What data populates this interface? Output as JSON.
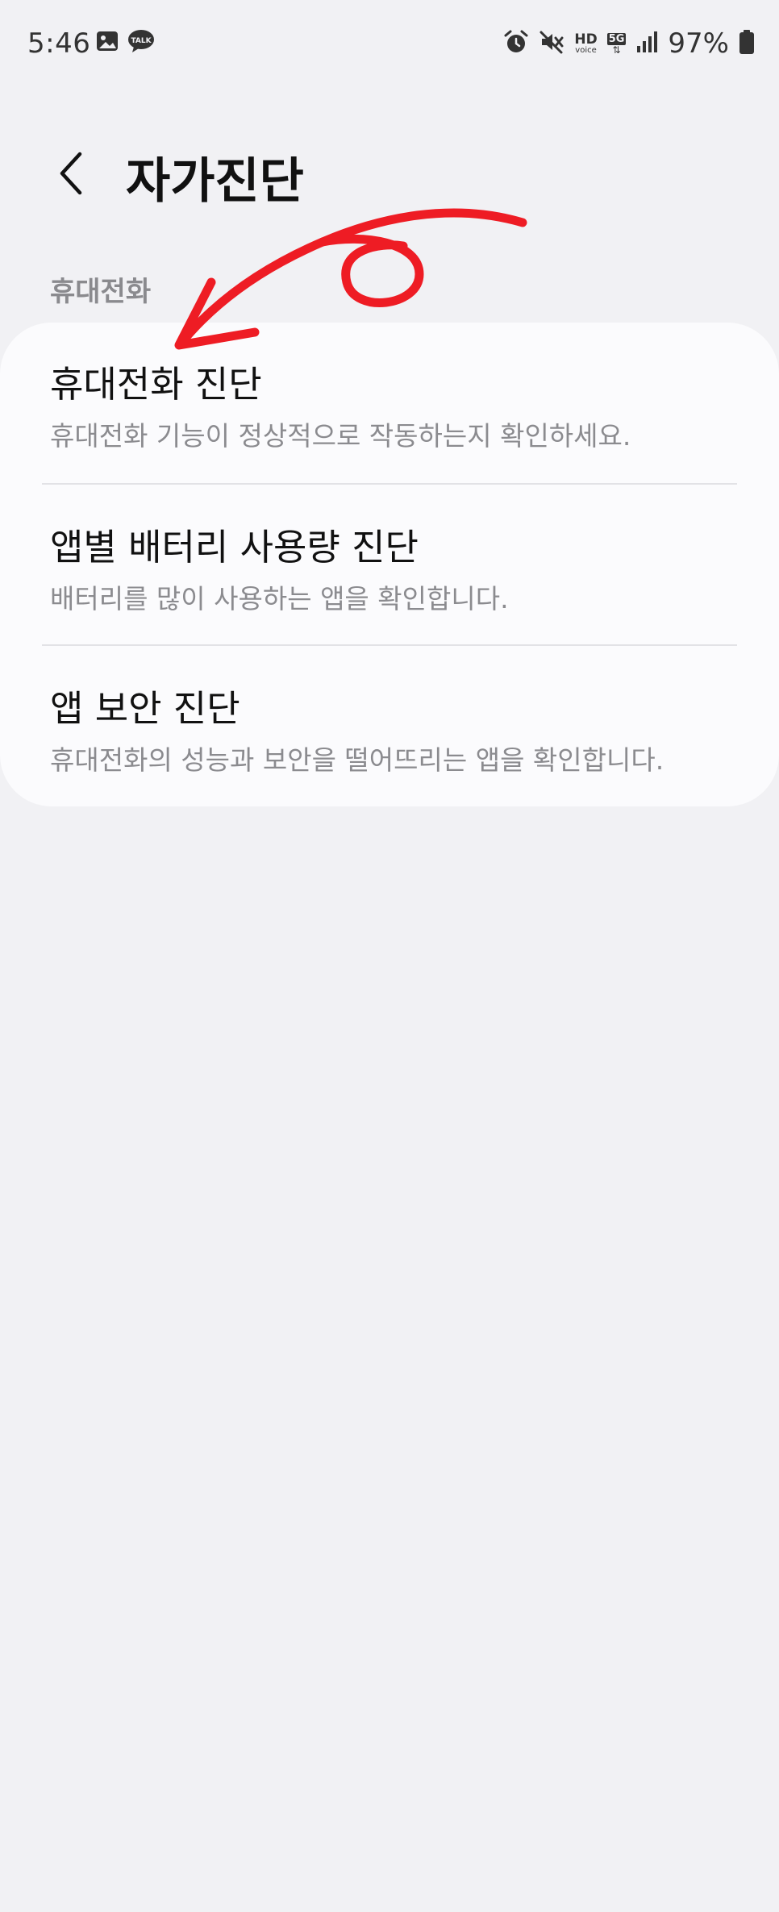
{
  "status_bar": {
    "time": "5:46",
    "battery": "97%",
    "hd_label": "HD",
    "voice_label": "voice",
    "net_label": "5G"
  },
  "header": {
    "title": "자가진단"
  },
  "section": {
    "label": "휴대전화"
  },
  "items": [
    {
      "title": "휴대전화 진단",
      "subtitle": "휴대전화 기능이 정상적으로 작동하는지 확인하세요."
    },
    {
      "title": "앱별 배터리 사용량 진단",
      "subtitle": "배터리를 많이 사용하는 앱을 확인합니다."
    },
    {
      "title": "앱 보안 진단",
      "subtitle": "휴대전화의 성능과 보안을 떨어뜨리는 앱을 확인합니다."
    }
  ],
  "colors": {
    "background": "#f1f1f4",
    "card": "#fbfbfd",
    "annotation": "#ee1c24"
  }
}
